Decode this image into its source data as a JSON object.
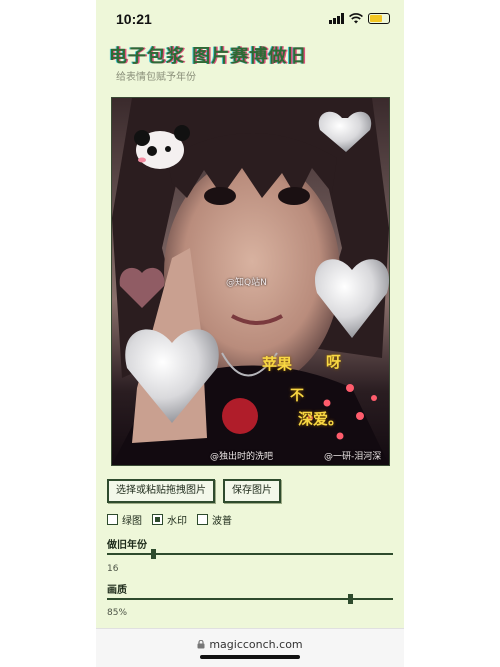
{
  "status": {
    "time": "10:21"
  },
  "app": {
    "title": "电子包浆 图片赛博做旧",
    "subtitle": "给表情包赋予年份"
  },
  "photo": {
    "watermark_center": "@知Q站N",
    "watermark_bottom_left": "@独出时的洗吧",
    "watermark_bottom_right": "@一研-泪河深",
    "sticker_text_1": "苹果",
    "sticker_text_2": "呀",
    "sticker_text_3": "不",
    "sticker_text_4": "深爱。"
  },
  "buttons": {
    "choose": "选择或粘贴拖拽图片",
    "save": "保存图片"
  },
  "options": [
    {
      "label": "绿图",
      "checked": false
    },
    {
      "label": "水印",
      "checked": true
    },
    {
      "label": "波普",
      "checked": false
    }
  ],
  "controls": {
    "age_label": "做旧年份",
    "age_value": "16",
    "age_fraction": 0.16,
    "quality_label": "画质",
    "quality_value": "85%",
    "quality_fraction": 0.85
  },
  "browser": {
    "url": "magicconch.com",
    "lock_icon": "lock-icon"
  },
  "colors": {
    "accent": "#2e4b2d",
    "background": "#eef7d9",
    "title_green": "#2e6a35"
  }
}
